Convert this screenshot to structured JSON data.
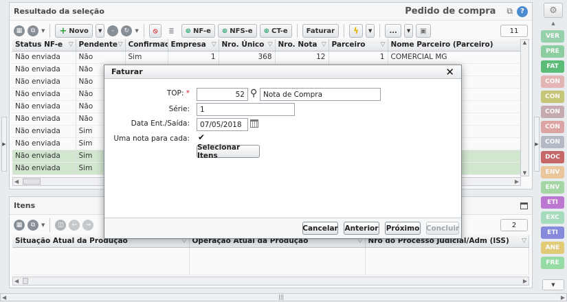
{
  "top_panel": {
    "title": "Resultado da seleção",
    "form_title": "Pedido de compra",
    "record_count": "11",
    "toolbar": {
      "novo": "Novo",
      "nfe": "NF-e",
      "nfse": "NFS-e",
      "cte": "CT-e",
      "faturar": "Faturar",
      "more": "..."
    },
    "columns": [
      "Status NF-e",
      "Pendente",
      "Confirmada",
      "Empresa",
      "Nro. Único",
      "Nro. Nota",
      "Parceiro",
      "Nome Parceiro (Parceiro)"
    ],
    "rows": [
      {
        "status": "Não enviada",
        "pendente": "Não",
        "confirmada": "Sim",
        "empresa": "1",
        "nro_unico": "368",
        "nro_nota": "12",
        "parceiro": "1",
        "nome": "COMERCIAL MG"
      },
      {
        "status": "Não enviada",
        "pendente": "Não"
      },
      {
        "status": "Não enviada",
        "pendente": "Não"
      },
      {
        "status": "Não enviada",
        "pendente": "Não"
      },
      {
        "status": "Não enviada",
        "pendente": "Não"
      },
      {
        "status": "Não enviada",
        "pendente": "Não"
      },
      {
        "status": "Não enviada",
        "pendente": "Sim"
      },
      {
        "status": "Não enviada",
        "pendente": "Sim"
      },
      {
        "status": "Não enviada",
        "pendente": "Sim"
      },
      {
        "status": "Não enviada",
        "pendente": "Sim"
      }
    ]
  },
  "items_panel": {
    "title": "Itens",
    "record_count": "2",
    "columns": [
      "Situação Atual da Produção",
      "Operação Atual da Produção",
      "Nro do Processo Judicial/Adm (ISS)"
    ]
  },
  "dialog": {
    "title": "Faturar",
    "top_label": "TOP:",
    "top_value": "52",
    "top_desc": "Nota de Compra",
    "serie_label": "Série:",
    "serie_value": "1",
    "data_label": "Data Ent./Saída:",
    "data_value": "07/05/2018",
    "uma_nota_label": "Uma nota para cada:",
    "selecionar_itens": "Selecionar Itens",
    "cancelar": "Cancelar",
    "anterior": "Anterior",
    "proximo": "Próximo",
    "concluir": "Concluir"
  },
  "sidebar": [
    {
      "label": "VER",
      "color": "#9ad6b0"
    },
    {
      "label": "PRE",
      "color": "#8fd3a3"
    },
    {
      "label": "FAT",
      "color": "#5cc07a"
    },
    {
      "label": "CON",
      "color": "#e8b8b8"
    },
    {
      "label": "CON",
      "color": "#c9c97a"
    },
    {
      "label": "CON",
      "color": "#c9aeb4"
    },
    {
      "label": "CON",
      "color": "#e2a8a8"
    },
    {
      "label": "CON",
      "color": "#b8bec9"
    },
    {
      "label": "DOC",
      "color": "#c96a6a"
    },
    {
      "label": "ENV",
      "color": "#f0c9a0"
    },
    {
      "label": "ENV",
      "color": "#a8dba8"
    },
    {
      "label": "ETI",
      "color": "#c07ad6"
    },
    {
      "label": "EXC",
      "color": "#a8e0c0"
    },
    {
      "label": "ETI",
      "color": "#8a8ee0"
    },
    {
      "label": "ANE",
      "color": "#e6d07a"
    },
    {
      "label": "FRE",
      "color": "#9ae0a8"
    }
  ]
}
